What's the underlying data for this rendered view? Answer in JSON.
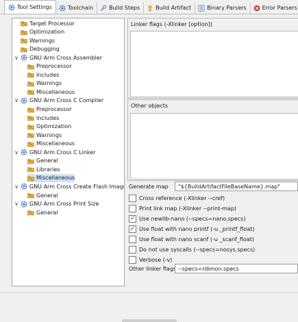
{
  "tabs": [
    {
      "label": "Tool Settings",
      "icon": "tool-settings-icon",
      "active": true
    },
    {
      "label": "Toolchain",
      "icon": "toolchain-icon",
      "active": false
    },
    {
      "label": "Build Steps",
      "icon": "build-steps-icon",
      "active": false
    },
    {
      "label": "Build Artifact",
      "icon": "build-artifact-icon",
      "active": false
    },
    {
      "label": "Binary Parsers",
      "icon": "binary-parsers-icon",
      "active": false
    },
    {
      "label": "Error Parsers",
      "icon": "error-parsers-icon",
      "active": false
    }
  ],
  "tree": [
    {
      "label": "Target Processor",
      "level": 1,
      "kind": "leaf"
    },
    {
      "label": "Optimization",
      "level": 1,
      "kind": "leaf"
    },
    {
      "label": "Warnings",
      "level": 1,
      "kind": "leaf"
    },
    {
      "label": "Debugging",
      "level": 1,
      "kind": "leaf"
    },
    {
      "label": "GNU Arm Cross Assembler",
      "level": 0,
      "kind": "tool",
      "expanded": true
    },
    {
      "label": "Preprocessor",
      "level": 1,
      "kind": "leaf"
    },
    {
      "label": "Includes",
      "level": 1,
      "kind": "leaf"
    },
    {
      "label": "Warnings",
      "level": 1,
      "kind": "leaf"
    },
    {
      "label": "Miscellaneous",
      "level": 1,
      "kind": "leaf"
    },
    {
      "label": "GNU Arm Cross C Compiler",
      "level": 0,
      "kind": "tool",
      "expanded": true
    },
    {
      "label": "Preprocessor",
      "level": 1,
      "kind": "leaf"
    },
    {
      "label": "Includes",
      "level": 1,
      "kind": "leaf"
    },
    {
      "label": "Optimization",
      "level": 1,
      "kind": "leaf"
    },
    {
      "label": "Warnings",
      "level": 1,
      "kind": "leaf"
    },
    {
      "label": "Miscellaneous",
      "level": 1,
      "kind": "leaf"
    },
    {
      "label": "GNU Arm Cross C Linker",
      "level": 0,
      "kind": "tool",
      "expanded": true
    },
    {
      "label": "General",
      "level": 1,
      "kind": "leaf"
    },
    {
      "label": "Libraries",
      "level": 1,
      "kind": "leaf"
    },
    {
      "label": "Miscellaneous",
      "level": 1,
      "kind": "leaf",
      "selected": true
    },
    {
      "label": "GNU Arm Cross Create Flash Image",
      "level": 0,
      "kind": "tool",
      "expanded": true
    },
    {
      "label": "General",
      "level": 1,
      "kind": "leaf"
    },
    {
      "label": "GNU Arm Cross Print Size",
      "level": 0,
      "kind": "tool",
      "expanded": true
    },
    {
      "label": "General",
      "level": 1,
      "kind": "leaf"
    }
  ],
  "linker_flags": {
    "label": "Linker flags (-Xlinker [option])"
  },
  "other_objects": {
    "label": "Other objects"
  },
  "generate_map": {
    "label": "Generate map",
    "value": "\"${BuildArtifactFileBaseName}.map\""
  },
  "options": [
    {
      "label": "Cross reference (-Xlinker --cref)",
      "checked": false
    },
    {
      "label": "Print link map (-Xlinker --print-map)",
      "checked": false
    },
    {
      "label": "Use newlib-nano (--specs=nano.specs)",
      "checked": true
    },
    {
      "label": "Use float with nano printf (-u _printf_float)",
      "checked": true
    },
    {
      "label": "Use float with nano scanf (-u _scanf_float)",
      "checked": false
    },
    {
      "label": "Do not use syscalls (--specs=nosys.specs)",
      "checked": false
    },
    {
      "label": "Verbose (-v)",
      "checked": false
    }
  ],
  "other_linker_flags": {
    "label": "Other linker flags",
    "value": "--specs=rdimon.specs"
  },
  "colors": {
    "selection": "#cfe3f7",
    "folder": "#e8b43c",
    "gear": "#2f6fb3"
  }
}
